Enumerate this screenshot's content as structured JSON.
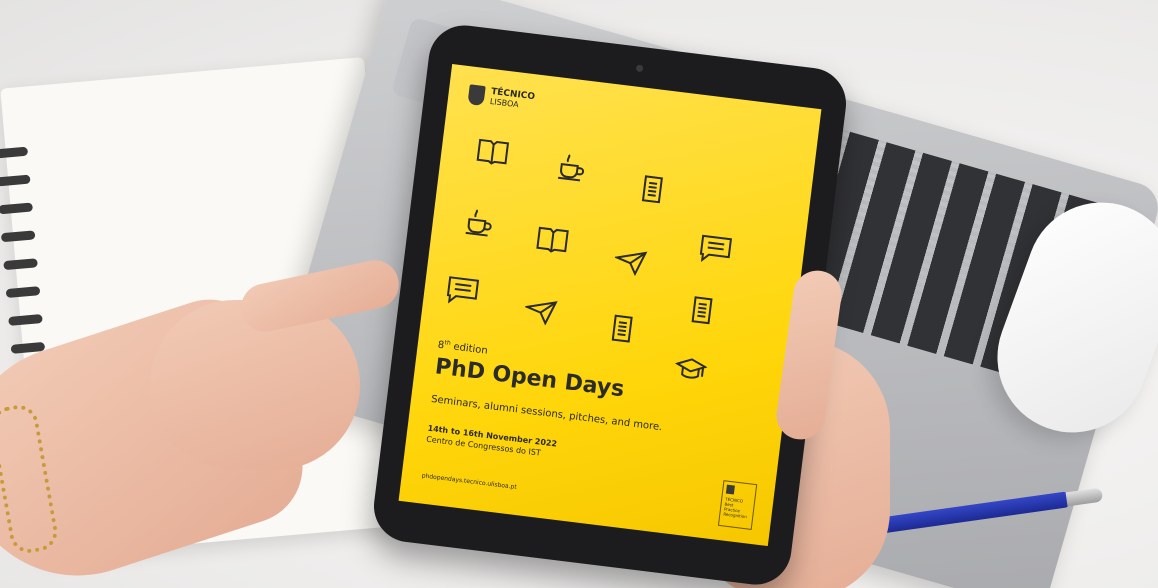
{
  "poster": {
    "brand": {
      "line1": "TÉCNICO",
      "line2": "LISBOA"
    },
    "edition_number": "8",
    "edition_suffix": "th",
    "edition_word": "edition",
    "title": "PhD Open Days",
    "subtitle": "Seminars, alumni sessions, pitches, and more.",
    "dates": "14th to 16th November 2022",
    "venue": "Centro de Congressos do IST",
    "url": "phdopendays.tecnico.ulisboa.pt",
    "badge": {
      "brand": "TÉCNICO",
      "text": "Best Practice Recognition"
    }
  },
  "colors": {
    "poster_background": "#ffd60a",
    "icon_stroke": "#2b2b2b",
    "tablet_bezel": "#1c1c1e",
    "pen": "#2a3bb7"
  },
  "icons": [
    "open-book-icon",
    "coffee-cup-icon",
    "document-icon",
    "coffee-cup-icon",
    "open-book-icon",
    "paper-plane-icon",
    "chat-bubble-icon",
    "chat-bubble-icon",
    "paper-plane-icon",
    "document-icon",
    "document-icon",
    "graduation-cap-icon"
  ]
}
